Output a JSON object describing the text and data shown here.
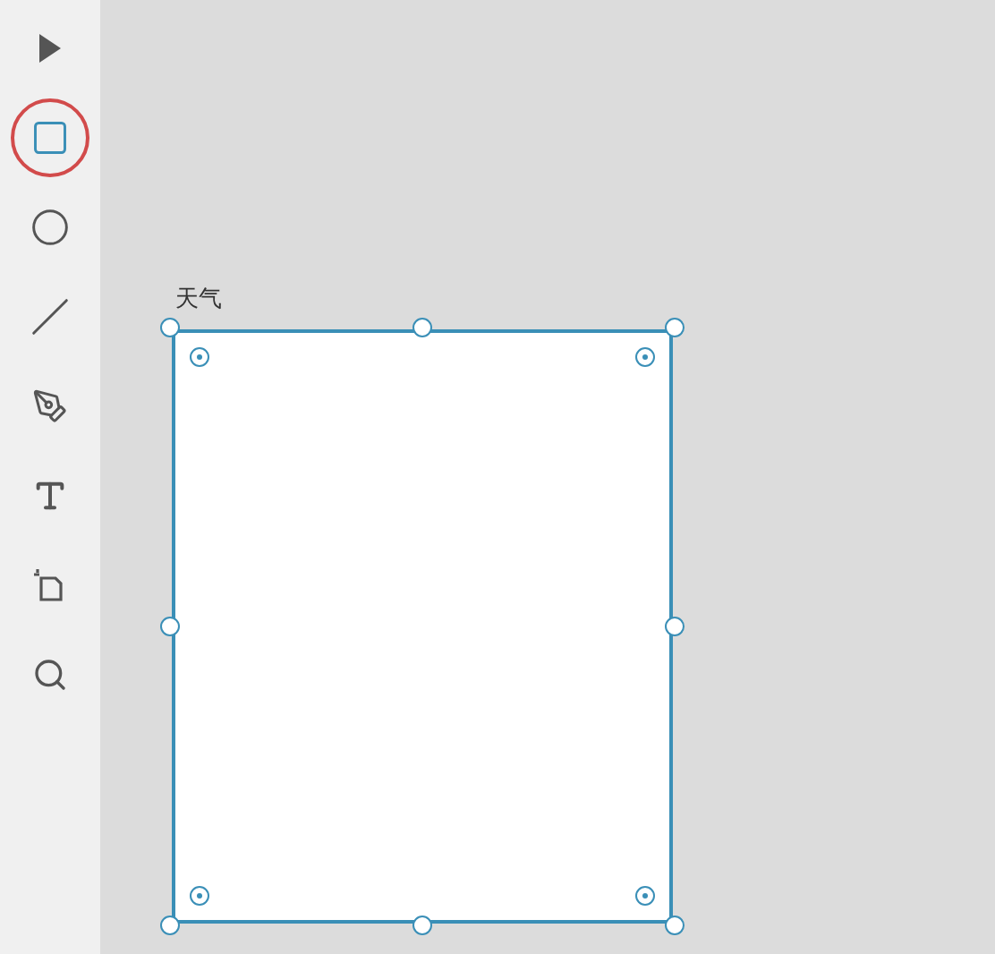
{
  "toolbar": {
    "tools": [
      {
        "kind": "select",
        "selected": false
      },
      {
        "kind": "rectangle",
        "selected": true
      },
      {
        "kind": "ellipse",
        "selected": false
      },
      {
        "kind": "line",
        "selected": false
      },
      {
        "kind": "pen",
        "selected": false
      },
      {
        "kind": "text",
        "selected": false
      },
      {
        "kind": "artboard",
        "selected": false
      },
      {
        "kind": "zoom",
        "selected": false
      }
    ]
  },
  "artboard": {
    "title": "天气",
    "selected": true
  }
}
